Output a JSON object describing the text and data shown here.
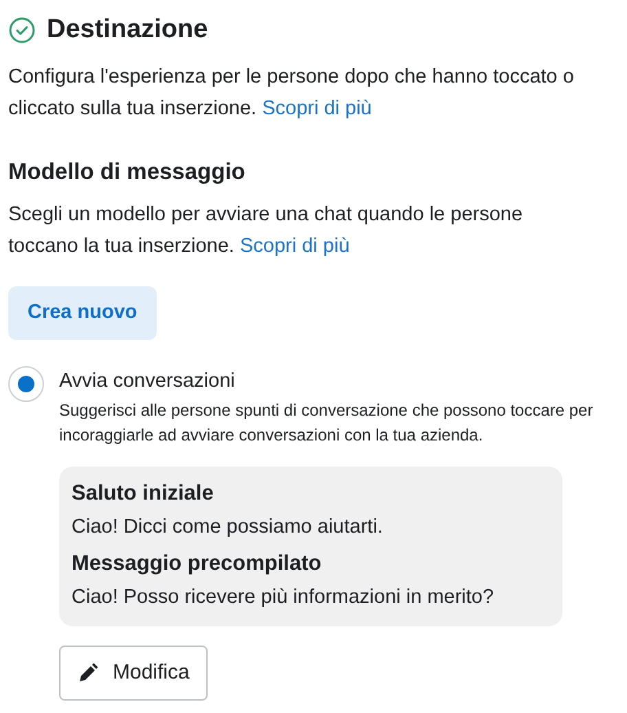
{
  "section": {
    "title": "Destinazione",
    "completed": true,
    "description": "Configura l'esperienza per le persone dopo che hanno toccato o cliccato sulla tua inserzione.",
    "link": "Scopri di più"
  },
  "template": {
    "title": "Modello di messaggio",
    "description": "Scegli un modello per avviare una chat quando le persone toccano la tua inserzione.",
    "link": "Scopri di più",
    "create_button": "Crea nuovo"
  },
  "options": [
    {
      "label": "Avvia conversazioni",
      "description": "Suggerisci alle persone spunti di conversazione che possono toccare per incoraggiarle ad avviare conversazioni con la tua azienda.",
      "selected": true,
      "card": [
        {
          "heading": "Saluto iniziale",
          "text": "Ciao! Dicci come possiamo aiutarti."
        },
        {
          "heading": "Messaggio precompilato",
          "text": "Ciao! Posso ricevere più informazioni in merito?"
        }
      ],
      "edit_button": "Modifica"
    }
  ]
}
